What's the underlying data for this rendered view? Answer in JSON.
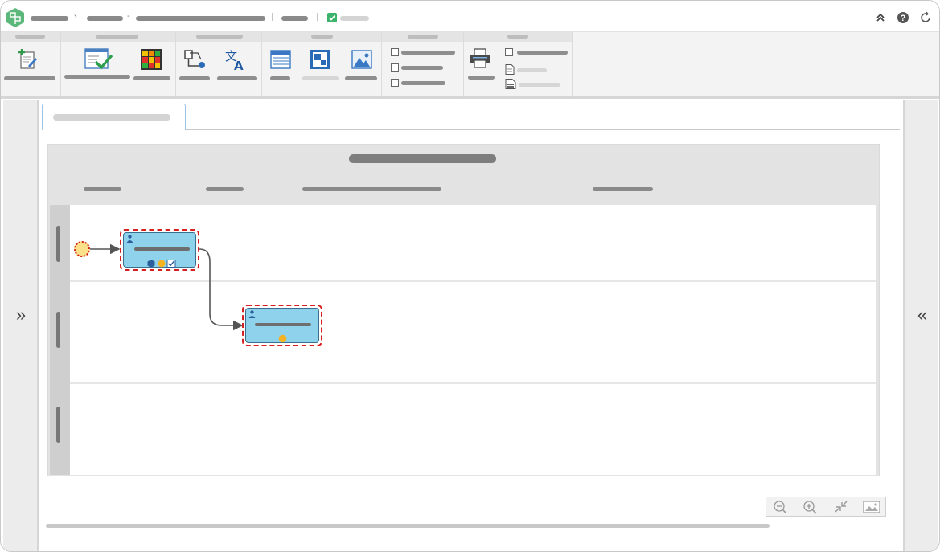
{
  "app": {
    "title": "",
    "icons": [
      "app-logo-icon",
      "collapse-up-icon",
      "help-icon",
      "refresh-icon"
    ],
    "accent_color": "#3bb36b"
  },
  "breadcrumb": {
    "separator": "›",
    "dash": "-"
  },
  "ribbon": {
    "icons": [
      "edit-document-icon",
      "validate-checklist-icon",
      "color-grid-icon",
      "flow-connector-icon",
      "translate-icon",
      "table-layout-icon",
      "fit-zoom-icon",
      "image-icon",
      "print-icon",
      "document-icon",
      "document-lines-icon"
    ]
  },
  "panels": {
    "expand_left_glyph": "»",
    "expand_right_glyph": "«"
  },
  "diagram": {
    "task_color": "#8fd2ec",
    "selection_color": "#d42020",
    "start_event_color": "#fce08a"
  }
}
